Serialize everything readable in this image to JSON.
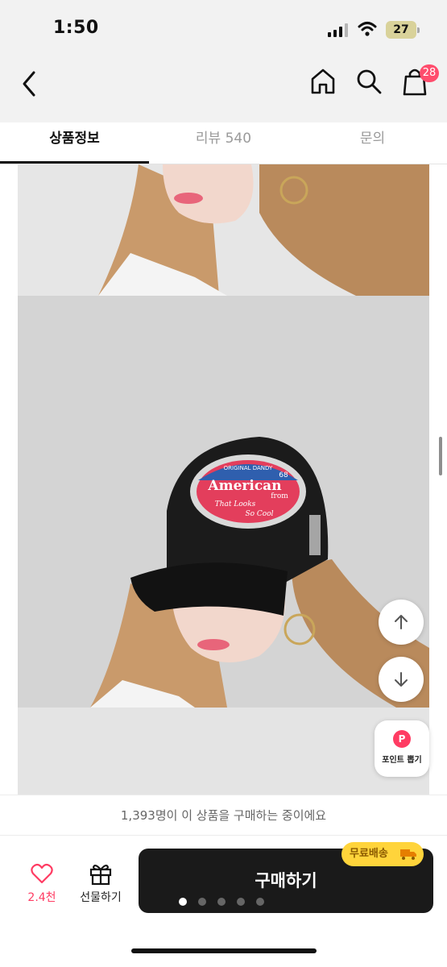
{
  "status_bar": {
    "time": "1:50",
    "battery": "27"
  },
  "header": {
    "icons": [
      "back-icon",
      "home-icon",
      "search-icon",
      "cart-icon"
    ],
    "cart_count": "28"
  },
  "tabs": [
    {
      "label": "상품정보",
      "active": true
    },
    {
      "label": "리뷰 540",
      "active": false
    },
    {
      "label": "문의",
      "active": false
    }
  ],
  "product_photo": {
    "patch_top": "ORIGINAL DANDY",
    "patch_number": "68",
    "patch_main": "American",
    "patch_from": "from",
    "patch_line1": "That Looks",
    "patch_line2": "So Cool"
  },
  "floating": {
    "scroll_up_icon": "arrow-up-icon",
    "scroll_down_icon": "arrow-down-icon",
    "point_badge": "P",
    "point_label": "포인트 뽑기"
  },
  "info_banner": "1,393명이 이 상품을 구매하는 중이에요",
  "bottom_bar": {
    "like_count": "2.4천",
    "gift_label": "선물하기",
    "buy_label": "구매하기",
    "free_shipping": "무료배송"
  },
  "carousel": {
    "count": 5,
    "active_index": 0
  },
  "colors": {
    "accent_pink": "#ff3c63",
    "free_shipping_bg": "#ffd43b",
    "buy_button": "#1a1a1a"
  }
}
